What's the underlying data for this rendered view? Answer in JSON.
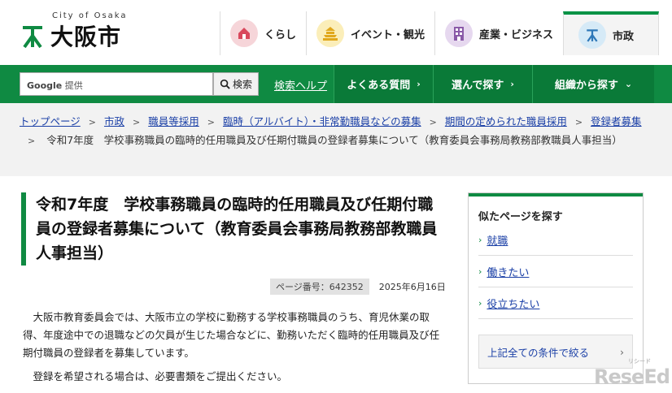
{
  "header": {
    "logo_sub": "City of Osaka",
    "logo_text": "大阪市",
    "nav": [
      {
        "label": "くらし",
        "icon": "house-icon",
        "color": "#f6d5d9",
        "icon_color": "#d9485c"
      },
      {
        "label": "イベント・観光",
        "icon": "castle-icon",
        "color": "#fbeeb9",
        "icon_color": "#e1a81c"
      },
      {
        "label": "産業・ビジネス",
        "icon": "building-icon",
        "color": "#e6d8ef",
        "icon_color": "#8a5aa8"
      },
      {
        "label": "市政",
        "icon": "city-emblem-icon",
        "color": "#d6eaf7",
        "icon_color": "#2f78b8"
      }
    ]
  },
  "search": {
    "google_label": "Google",
    "google_suffix": "提供",
    "button_label": "検索",
    "help_label": "検索ヘルプ"
  },
  "gnav": [
    {
      "label": "よくある質問",
      "chev": "›"
    },
    {
      "label": "選んで探す",
      "chev": "›"
    },
    {
      "label": "組織から探す",
      "chev": "⌄"
    }
  ],
  "breadcrumb": {
    "links": [
      "トップページ",
      "市政",
      "職員等採用",
      "臨時（アルバイト）・非常勤職員などの募集",
      "期間の定められた職員採用",
      "登録者募集"
    ],
    "current": "令和7年度　学校事務職員の臨時的任用職員及び任期付職員の登録者募集について（教育委員会事務局教務部教職員人事担当）"
  },
  "article": {
    "title": "令和7年度　学校事務職員の臨時的任用職員及び任期付職員の登録者募集について（教育委員会事務局教務部教職員人事担当）",
    "page_number": "ページ番号：642352",
    "date": "2025年6月16日",
    "paragraphs": [
      "大阪市教育委員会では、大阪市立の学校に勤務する学校事務職員のうち、育児休業の取得、年度途中での退職などの欠員が生じた場合などに、勤務いただく臨時的任用職員及び任期付職員の登録者を募集しています。",
      "登録を希望される場合は、必要書類をご提出ください。"
    ]
  },
  "sidebar": {
    "title": "似たページを探す",
    "items": [
      "就職",
      "働きたい",
      "役立ちたい"
    ],
    "all_label": "上記全ての条件で絞る"
  },
  "watermark": {
    "text": "ReseEd",
    "small": "リシード"
  },
  "colors": {
    "brand_green": "#0f8a42",
    "link": "#1a3fa6"
  }
}
